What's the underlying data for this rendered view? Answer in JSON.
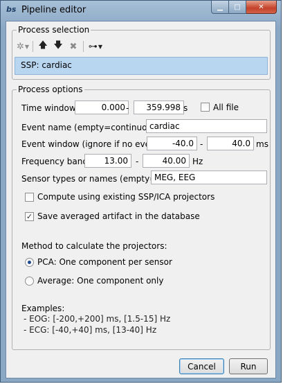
{
  "window": {
    "title": "Pipeline editor",
    "min_glyph": "▁",
    "max_glyph": "□",
    "close_glyph": "✕",
    "app_glyph": "bs"
  },
  "process_selection": {
    "label": "Process selection",
    "toolbar": {
      "run_glyph": "✲",
      "up_glyph": "🡅",
      "down_glyph": "🡇",
      "delete_glyph": "✖",
      "tree_glyph": "⊶"
    },
    "items": [
      {
        "label": "SSP: cardiac"
      }
    ]
  },
  "process_options": {
    "label": "Process options",
    "time_window": {
      "label": "Time window:",
      "start": "0.000",
      "dash": "-",
      "end": "359.998",
      "unit": "s",
      "all_file_label": "All file",
      "all_file_checked": false
    },
    "event_name": {
      "label": "Event name (empty=continuous):",
      "value": "cardiac"
    },
    "event_window": {
      "label": "Event window (ignore if no event):",
      "start": "-40.0",
      "dash": "-",
      "end": "40.0",
      "unit": "ms"
    },
    "frequency_band": {
      "label": "Frequency band:",
      "low": "13.00",
      "dash": "-",
      "high": "40.00",
      "unit": "Hz"
    },
    "sensor_types": {
      "label": "Sensor types or names (empty=all):",
      "value": "MEG, EEG"
    },
    "compute_existing": {
      "label": "Compute using existing SSP/ICA projectors",
      "checked": false
    },
    "save_averaged": {
      "label": "Save averaged artifact in the database",
      "checked": true,
      "glyph": "✓"
    },
    "method_heading": "Method to calculate the projectors:",
    "method_options": [
      {
        "label": "PCA: One component per sensor",
        "selected": true
      },
      {
        "label": "Average: One component only",
        "selected": false
      }
    ],
    "examples_heading": "Examples:",
    "examples": [
      "- EOG: [-200,+200] ms, [1.5-15] Hz",
      "- ECG: [-40,+40] ms, [13-40] Hz"
    ]
  },
  "buttons": {
    "cancel": "Cancel",
    "run": "Run"
  }
}
